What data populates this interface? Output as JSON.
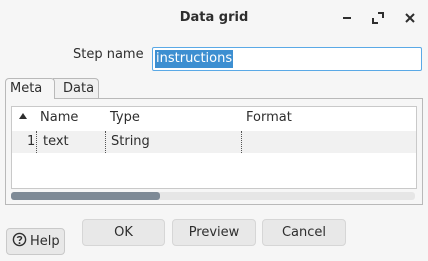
{
  "window": {
    "title": "Data grid"
  },
  "step": {
    "label": "Step name",
    "value": "instructions"
  },
  "tabs": [
    {
      "label": "Meta"
    },
    {
      "label": "Data"
    }
  ],
  "grid": {
    "columns": [
      "Name",
      "Type",
      "Format"
    ],
    "rows": [
      {
        "num": "1",
        "name": "text",
        "type": "String",
        "format": ""
      }
    ]
  },
  "buttons": {
    "ok": "OK",
    "preview": "Preview",
    "cancel": "Cancel",
    "help": "Help"
  },
  "icons": {
    "minimize": "minimize-icon",
    "maximize": "maximize-icon",
    "close": "close-icon",
    "help": "help-icon",
    "sort": "sort-ascending-icon"
  },
  "colors": {
    "accent": "#3d8fd1",
    "input_border": "#5aa9e6",
    "scroll_thumb": "#7e8a96"
  },
  "scrollbar": {
    "thumb_fraction": 0.37
  }
}
